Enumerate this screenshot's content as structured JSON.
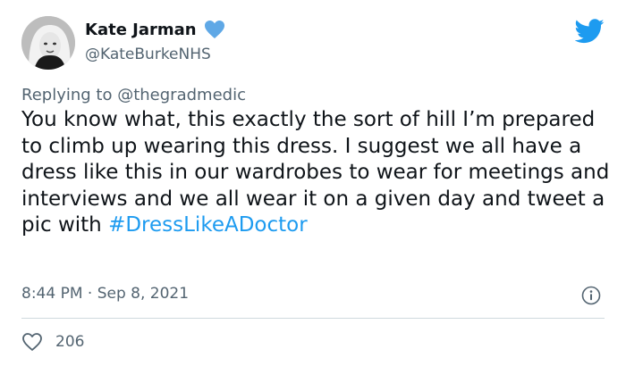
{
  "tweet": {
    "display_name": "Kate Jarman",
    "handle": "@KateBurkeNHS",
    "reply_prefix": "Replying to",
    "reply_to": "@thegradmedic",
    "text": "You know what, this exactly the sort of hill I’m prepared to climb up wearing this dress. I suggest we all have a dress like this in our wardrobes to wear for meetings and interviews and we all wear it on a given day and tweet a pic with",
    "hashtag": "#DressLikeADoctor",
    "timestamp": "8:44 PM · Sep 8, 2021",
    "like_count": "206"
  },
  "icons": {
    "verified": "blue-heart-icon",
    "brand": "twitter-bird-icon",
    "info": "info-icon",
    "like": "heart-outline-icon"
  },
  "colors": {
    "accent": "#1d9bf0",
    "secondary_text": "#536471",
    "heart_badge": "#5fa8e6"
  }
}
